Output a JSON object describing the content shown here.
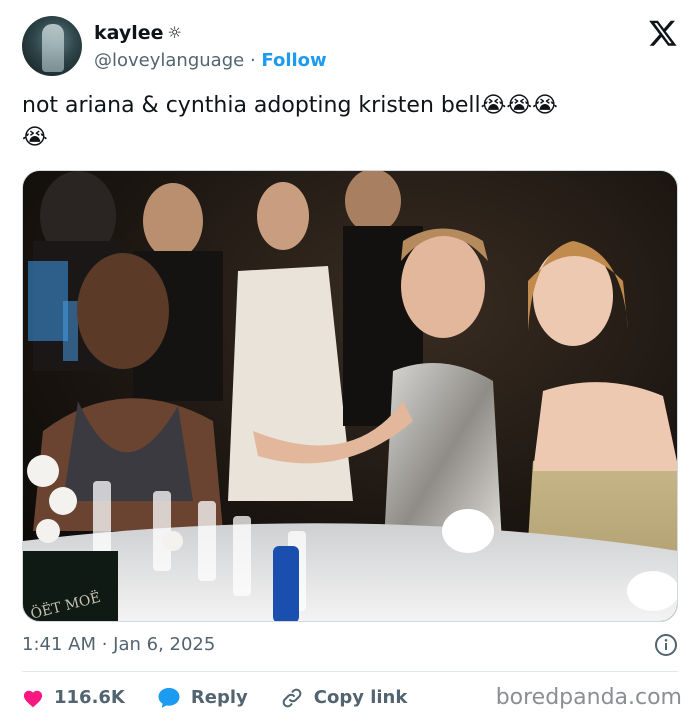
{
  "author": {
    "display_name": "kaylee",
    "badge_icon": "sun-icon",
    "handle": "@loveylanguage",
    "separator": "·",
    "follow_label": "Follow"
  },
  "post": {
    "text": "not ariana & cynthia adopting kristen bell",
    "emojis": [
      "😭",
      "😭",
      "😭",
      "😭"
    ],
    "timestamp": "1:41 AM · Jan 6, 2025"
  },
  "actions": {
    "like_count": "116.6K",
    "reply_label": "Reply",
    "copy_link_label": "Copy link"
  },
  "watermark": "boredpanda.com",
  "colors": {
    "accent": "#1d9bf0",
    "heart": "#f91880",
    "reply": "#1d9bf0",
    "secondary_text": "#536471"
  }
}
